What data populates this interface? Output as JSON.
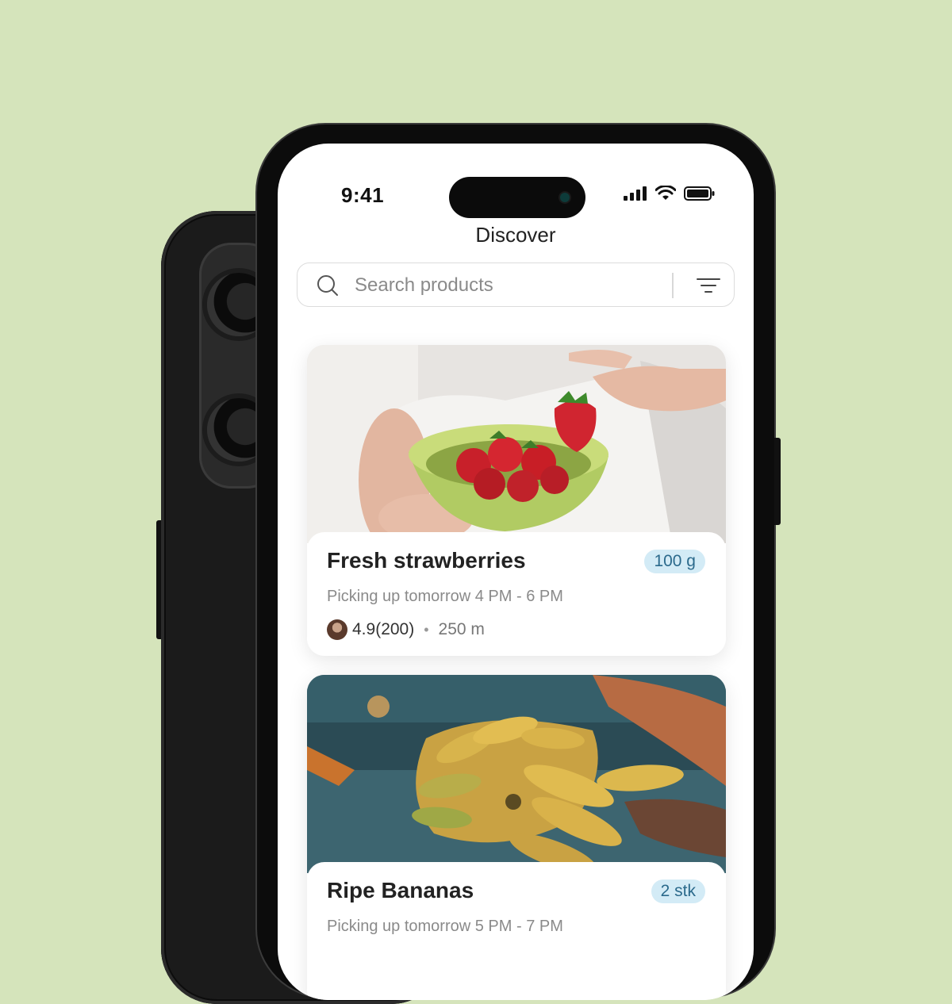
{
  "status": {
    "time": "9:41"
  },
  "nav": {
    "title": "Discover"
  },
  "search": {
    "placeholder": "Search products"
  },
  "products": [
    {
      "title": "Fresh strawberries",
      "badge": "100 g",
      "pickup": "Picking up tomorrow 4 PM - 6 PM",
      "rating": "4.9",
      "reviews": "(200)",
      "distance": "250 m"
    },
    {
      "title": "Ripe Bananas",
      "badge": "2 stk",
      "pickup": "Picking up tomorrow 5 PM - 7 PM"
    }
  ],
  "colors": {
    "background": "#d5e4bb",
    "badge_bg": "#d3ebf6",
    "badge_text": "#2b6a8c"
  }
}
